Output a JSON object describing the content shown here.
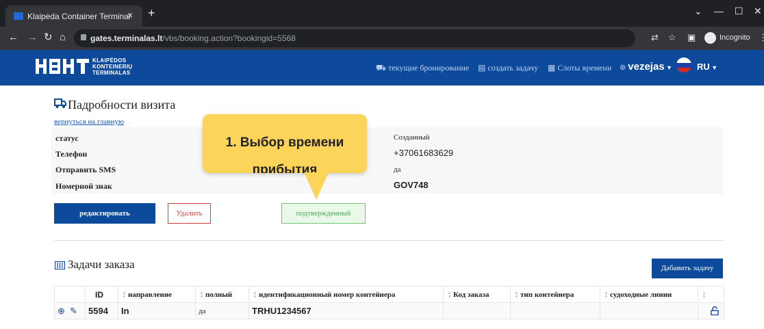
{
  "browser": {
    "tab_title": "Klaipėda Container Terminal",
    "tab_close": "×",
    "new_tab": "+",
    "url_host": "gates.terminalas.lt",
    "url_path": "/vbs/booking.action?bookingid=5568",
    "incognito_label": "Incognito",
    "icons": [
      "back-icon",
      "forward-icon",
      "reload-icon",
      "home-icon",
      "lock-icon",
      "translate-icon",
      "star-icon",
      "sidepanel-icon",
      "incognito-icon",
      "menu-icon",
      "minimize-icon",
      "maximize-icon",
      "close-icon",
      "tab-search-icon"
    ]
  },
  "header": {
    "logo_lines": [
      "KLAIPĖDOS",
      "KONTEINERIŲ",
      "TERMINALAS"
    ],
    "nav": [
      {
        "label": "текущие бронирование",
        "icon": "truck-icon"
      },
      {
        "label": "создать задачу",
        "icon": "container-icon"
      },
      {
        "label": "Слоты времени",
        "icon": "calendar-icon"
      }
    ],
    "user": "vezejas",
    "language": "RU"
  },
  "page": {
    "title": "Падробности визита",
    "back_link": "вернуться на главную",
    "details": [
      {
        "label": "статус",
        "value": "Созданный"
      },
      {
        "label": "Телефон",
        "value": "+37061683629"
      },
      {
        "label": "Отправить SMS",
        "value": "да"
      },
      {
        "label": "Номерной знак",
        "value": "GOV748"
      }
    ],
    "buttons": {
      "edit": "редактировать",
      "delete": "Удалить",
      "confirmed": "подтвержденный"
    }
  },
  "tasks": {
    "title": "Задачи заказа",
    "add_button": "Дабавить задачу",
    "columns": [
      "ID",
      "направление",
      "полный",
      "идентификационный номер контейнера",
      "Код заказа",
      "тип контейнера",
      "судоходные линии"
    ],
    "rows": [
      {
        "id": "5594",
        "direction": "In",
        "full": "да",
        "container": "TRHU1234567",
        "order_code": "",
        "container_type": "",
        "shipping_line": ""
      }
    ]
  },
  "callout": {
    "line1": "1. Выбор времени",
    "line2": "прибытия"
  },
  "colors": {
    "brand": "#0d4a9c",
    "callout": "#fcd45a",
    "delete": "#d23c3c",
    "confirmed": "#3fae4a"
  }
}
